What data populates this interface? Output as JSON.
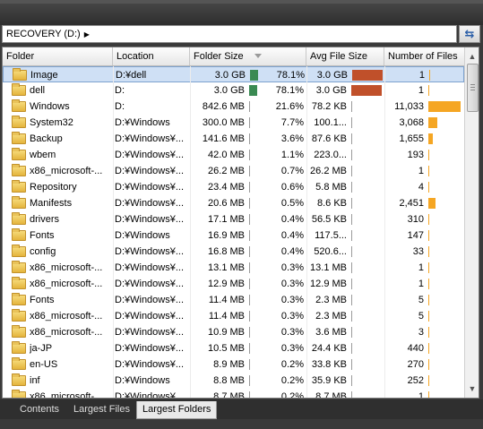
{
  "address": {
    "path": "RECOVERY (D:)",
    "refresh_icon": "refresh-icon"
  },
  "columns": [
    "Folder",
    "Location",
    "Folder Size",
    "Avg File Size",
    "Number of Files"
  ],
  "rows": [
    {
      "name": "Image",
      "location": "D:¥dell",
      "size": "3.0 GB",
      "pct": "78.1%",
      "avg": "3.0 GB",
      "count": "1",
      "size_frac": 0.781,
      "avg_frac": 1.0,
      "count_frac": 0.0,
      "selected": true
    },
    {
      "name": "dell",
      "location": "D:",
      "size": "3.0 GB",
      "pct": "78.1%",
      "avg": "3.0 GB",
      "count": "1",
      "size_frac": 0.781,
      "avg_frac": 1.0,
      "count_frac": 0.0
    },
    {
      "name": "Windows",
      "location": "D:",
      "size": "842.6 MB",
      "pct": "21.6%",
      "avg": "78.2 KB",
      "count": "11,033",
      "size_frac": 0.216,
      "avg_frac": 0.0,
      "count_frac": 1.0
    },
    {
      "name": "System32",
      "location": "D:¥Windows",
      "size": "300.0 MB",
      "pct": "7.7%",
      "avg": "100.1...",
      "count": "3,068",
      "size_frac": 0.077,
      "avg_frac": 0.0,
      "count_frac": 0.278
    },
    {
      "name": "Backup",
      "location": "D:¥Windows¥...",
      "size": "141.6 MB",
      "pct": "3.6%",
      "avg": "87.6 KB",
      "count": "1,655",
      "size_frac": 0.036,
      "avg_frac": 0.0,
      "count_frac": 0.15
    },
    {
      "name": "wbem",
      "location": "D:¥Windows¥...",
      "size": "42.0 MB",
      "pct": "1.1%",
      "avg": "223.0...",
      "count": "193",
      "size_frac": 0.011,
      "avg_frac": 0.0,
      "count_frac": 0.0
    },
    {
      "name": "x86_microsoft-...",
      "location": "D:¥Windows¥...",
      "size": "26.2 MB",
      "pct": "0.7%",
      "avg": "26.2 MB",
      "count": "1",
      "size_frac": 0.0,
      "avg_frac": 0.0,
      "count_frac": 0.0
    },
    {
      "name": "Repository",
      "location": "D:¥Windows¥...",
      "size": "23.4 MB",
      "pct": "0.6%",
      "avg": "5.8 MB",
      "count": "4",
      "size_frac": 0.0,
      "avg_frac": 0.0,
      "count_frac": 0.0
    },
    {
      "name": "Manifests",
      "location": "D:¥Windows¥...",
      "size": "20.6 MB",
      "pct": "0.5%",
      "avg": "8.6 KB",
      "count": "2,451",
      "size_frac": 0.0,
      "avg_frac": 0.0,
      "count_frac": 0.222
    },
    {
      "name": "drivers",
      "location": "D:¥Windows¥...",
      "size": "17.1 MB",
      "pct": "0.4%",
      "avg": "56.5 KB",
      "count": "310",
      "size_frac": 0.0,
      "avg_frac": 0.0,
      "count_frac": 0.0
    },
    {
      "name": "Fonts",
      "location": "D:¥Windows",
      "size": "16.9 MB",
      "pct": "0.4%",
      "avg": "117.5...",
      "count": "147",
      "size_frac": 0.0,
      "avg_frac": 0.0,
      "count_frac": 0.0
    },
    {
      "name": "config",
      "location": "D:¥Windows¥...",
      "size": "16.8 MB",
      "pct": "0.4%",
      "avg": "520.6...",
      "count": "33",
      "size_frac": 0.0,
      "avg_frac": 0.0,
      "count_frac": 0.0
    },
    {
      "name": "x86_microsoft-...",
      "location": "D:¥Windows¥...",
      "size": "13.1 MB",
      "pct": "0.3%",
      "avg": "13.1 MB",
      "count": "1",
      "size_frac": 0.0,
      "avg_frac": 0.0,
      "count_frac": 0.0
    },
    {
      "name": "x86_microsoft-...",
      "location": "D:¥Windows¥...",
      "size": "12.9 MB",
      "pct": "0.3%",
      "avg": "12.9 MB",
      "count": "1",
      "size_frac": 0.0,
      "avg_frac": 0.0,
      "count_frac": 0.0
    },
    {
      "name": "Fonts",
      "location": "D:¥Windows¥...",
      "size": "11.4 MB",
      "pct": "0.3%",
      "avg": "2.3 MB",
      "count": "5",
      "size_frac": 0.0,
      "avg_frac": 0.0,
      "count_frac": 0.0
    },
    {
      "name": "x86_microsoft-...",
      "location": "D:¥Windows¥...",
      "size": "11.4 MB",
      "pct": "0.3%",
      "avg": "2.3 MB",
      "count": "5",
      "size_frac": 0.0,
      "avg_frac": 0.0,
      "count_frac": 0.0
    },
    {
      "name": "x86_microsoft-...",
      "location": "D:¥Windows¥...",
      "size": "10.9 MB",
      "pct": "0.3%",
      "avg": "3.6 MB",
      "count": "3",
      "size_frac": 0.0,
      "avg_frac": 0.0,
      "count_frac": 0.0
    },
    {
      "name": "ja-JP",
      "location": "D:¥Windows¥...",
      "size": "10.5 MB",
      "pct": "0.3%",
      "avg": "24.4 KB",
      "count": "440",
      "size_frac": 0.0,
      "avg_frac": 0.0,
      "count_frac": 0.0
    },
    {
      "name": "en-US",
      "location": "D:¥Windows¥...",
      "size": "8.9 MB",
      "pct": "0.2%",
      "avg": "33.8 KB",
      "count": "270",
      "size_frac": 0.0,
      "avg_frac": 0.0,
      "count_frac": 0.0
    },
    {
      "name": "inf",
      "location": "D:¥Windows",
      "size": "8.8 MB",
      "pct": "0.2%",
      "avg": "35.9 KB",
      "count": "252",
      "size_frac": 0.0,
      "avg_frac": 0.0,
      "count_frac": 0.0
    },
    {
      "name": "x86_microsoft-...",
      "location": "D:¥Windows¥...",
      "size": "8.7 MB",
      "pct": "0.2%",
      "avg": "8.7 MB",
      "count": "1",
      "size_frac": 0.0,
      "avg_frac": 0.0,
      "count_frac": 0.0
    }
  ],
  "tabs": [
    {
      "label": "Contents",
      "active": false
    },
    {
      "label": "Largest Files",
      "active": false
    },
    {
      "label": "Largest Folders",
      "active": true
    }
  ],
  "colors": {
    "size_bar": "#3a8a52",
    "avg_bar": "#c0502a",
    "count_bar": "#f5a623",
    "selection": "#cfe0f5"
  }
}
